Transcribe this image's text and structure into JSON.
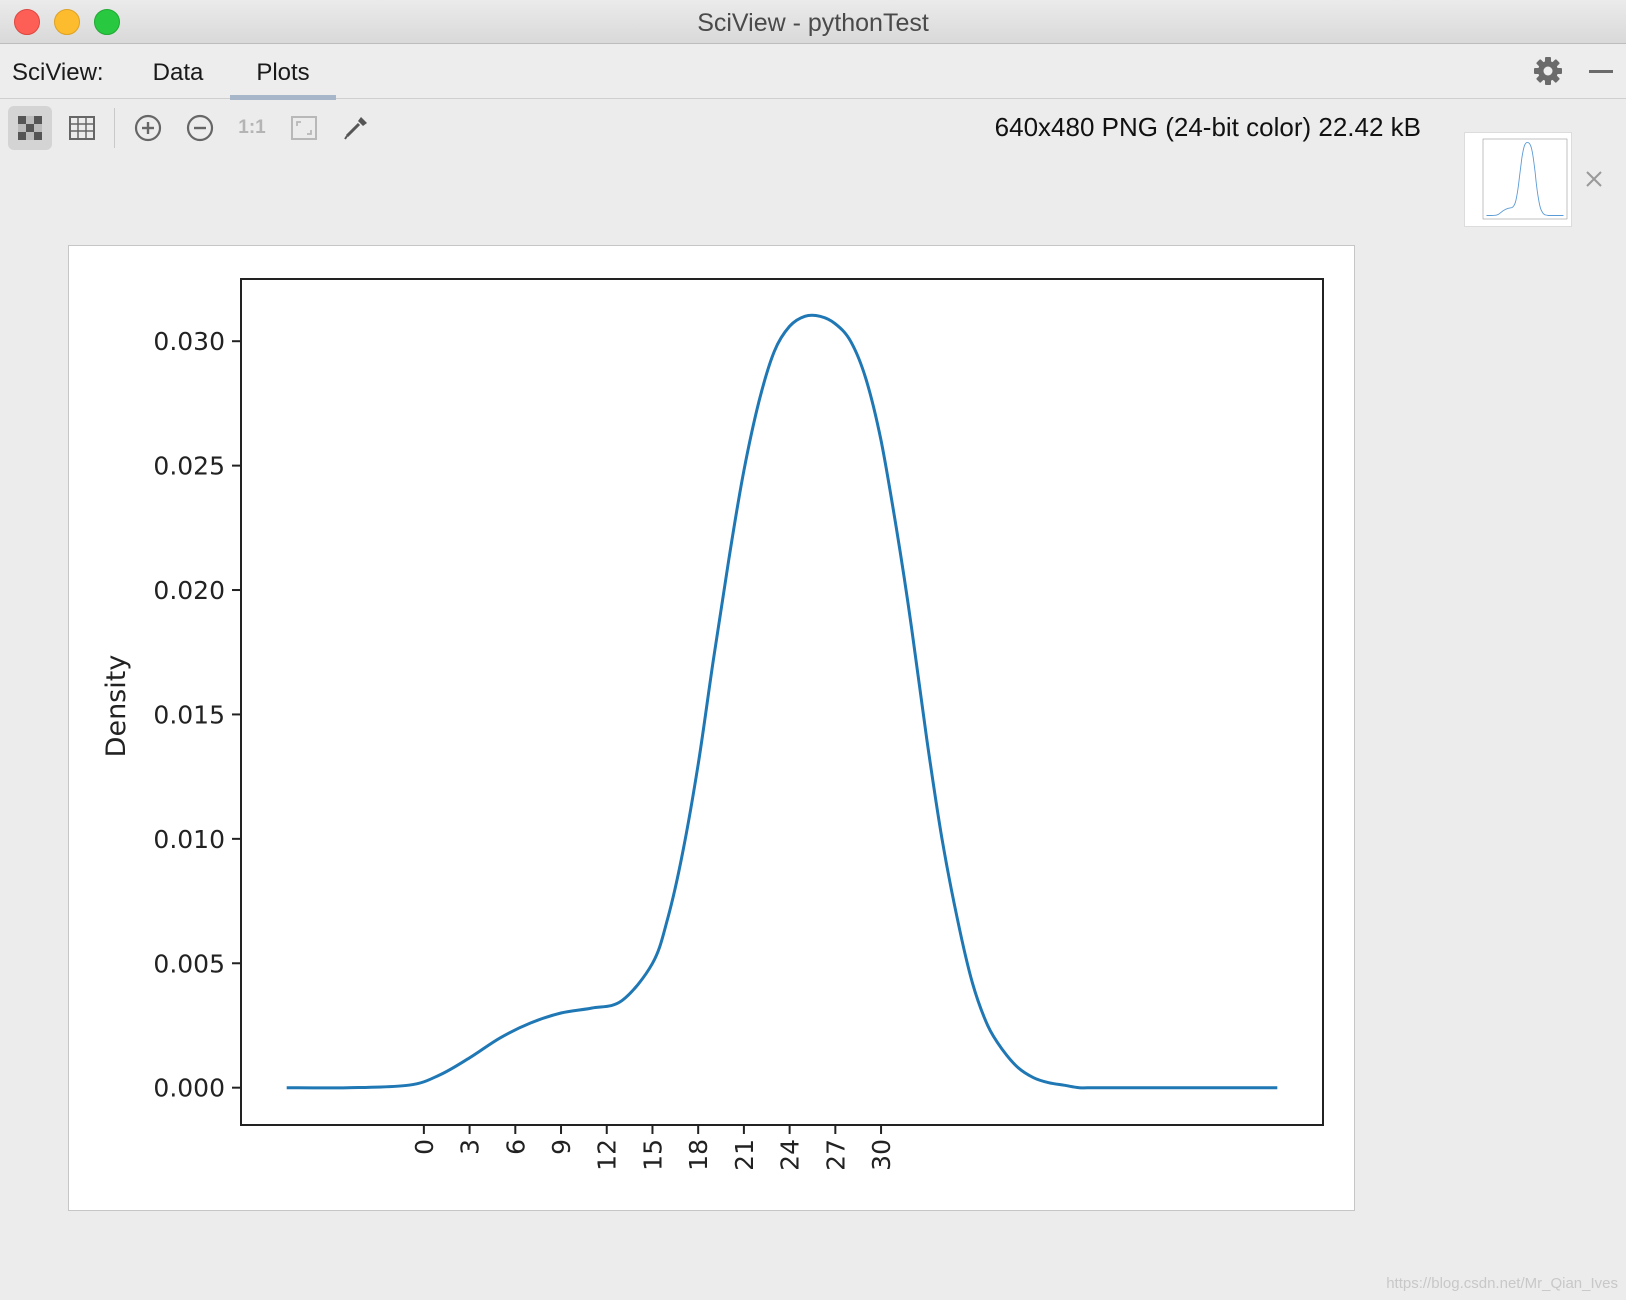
{
  "window": {
    "title": "SciView - pythonTest"
  },
  "tabbar": {
    "prefix": "SciView:",
    "tabs": [
      {
        "label": "Data",
        "active": false
      },
      {
        "label": "Plots",
        "active": true
      }
    ]
  },
  "toolbar": {
    "tools": [
      "zoom-to-fit",
      "grid",
      "zoom-in",
      "zoom-out",
      "actual-size",
      "fit-window",
      "color-picker"
    ],
    "ratio_label": "1:1",
    "image_info": "640x480 PNG (24-bit color) 22.42 kB"
  },
  "colors": {
    "line": "#1f77b4",
    "background": "#ececec"
  },
  "chart_data": {
    "type": "line",
    "title": "",
    "xlabel": "",
    "ylabel": "Density",
    "xlim": [
      -12,
      59
    ],
    "ylim": [
      -0.0015,
      0.0325
    ],
    "x_ticks": [
      0,
      3,
      6,
      9,
      12,
      15,
      18,
      21,
      24,
      27,
      30
    ],
    "y_ticks": [
      "0.000",
      "0.005",
      "0.010",
      "0.015",
      "0.020",
      "0.025",
      "0.030"
    ],
    "series": [
      {
        "x": [
          -9,
          -5,
          -1,
          1,
          3,
          5,
          7,
          9,
          11,
          13,
          15,
          16,
          17,
          18,
          19,
          20,
          21,
          22,
          23,
          24,
          25,
          26,
          27,
          28,
          29,
          30,
          31,
          32,
          33,
          34,
          35,
          36,
          37,
          38,
          39,
          40,
          41,
          42,
          43,
          44,
          46,
          48,
          50,
          52,
          54,
          56
        ],
        "y": [
          0.0,
          0.0,
          0.0001,
          0.0005,
          0.0012,
          0.002,
          0.0026,
          0.003,
          0.0032,
          0.0035,
          0.005,
          0.0068,
          0.0095,
          0.013,
          0.0172,
          0.0212,
          0.0248,
          0.0276,
          0.0296,
          0.0306,
          0.031,
          0.031,
          0.0307,
          0.03,
          0.0285,
          0.026,
          0.0225,
          0.0185,
          0.014,
          0.01,
          0.0068,
          0.0042,
          0.0025,
          0.0015,
          0.0008,
          0.0004,
          0.0002,
          0.0001,
          0.0,
          0.0,
          0.0,
          0.0,
          0.0,
          0.0,
          0.0,
          0.0
        ]
      }
    ]
  },
  "watermark": "https://blog.csdn.net/Mr_Qian_Ives"
}
